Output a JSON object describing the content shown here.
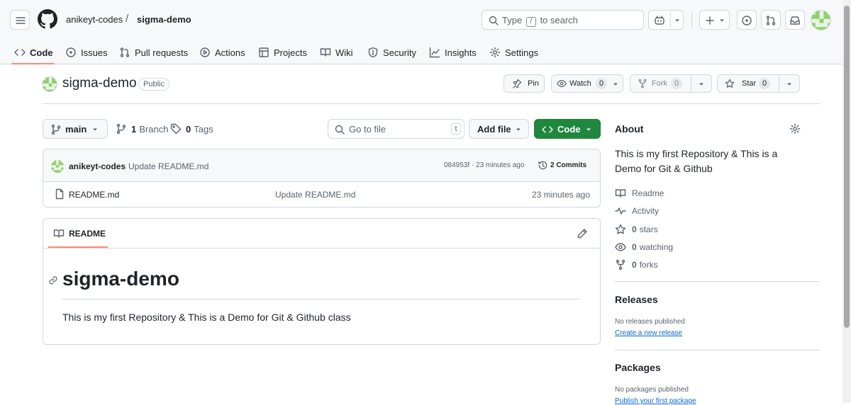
{
  "header": {
    "owner": "anikeyt-codes",
    "separator": "/",
    "repo": "sigma-demo",
    "search_prefix": "Type",
    "search_key": "/",
    "search_suffix": "to search"
  },
  "tabs": [
    {
      "label": "Code",
      "icon": "code-icon",
      "selected": true
    },
    {
      "label": "Issues",
      "icon": "issue-icon"
    },
    {
      "label": "Pull requests",
      "icon": "pull-request-icon"
    },
    {
      "label": "Actions",
      "icon": "play-icon"
    },
    {
      "label": "Projects",
      "icon": "table-icon"
    },
    {
      "label": "Wiki",
      "icon": "book-icon"
    },
    {
      "label": "Security",
      "icon": "shield-icon"
    },
    {
      "label": "Insights",
      "icon": "graph-icon"
    },
    {
      "label": "Settings",
      "icon": "gear-icon"
    }
  ],
  "repo": {
    "name": "sigma-demo",
    "visibility": "Public",
    "pin_label": "Pin",
    "watch_label": "Watch",
    "watch_count": "0",
    "fork_label": "Fork",
    "fork_count": "0",
    "star_label": "Star",
    "star_count": "0"
  },
  "controls": {
    "branch": "main",
    "branch_count": "1",
    "branch_label": "Branch",
    "tag_count": "0",
    "tag_label": "Tags",
    "goto_placeholder": "Go to file",
    "goto_key": "t",
    "add_file": "Add file",
    "code": "Code"
  },
  "commit": {
    "author": "anikeyt-codes",
    "message": "Update README.md",
    "meta": "084953f · 23 minutes ago",
    "commits": "2 Commits"
  },
  "files": [
    {
      "name": "README.md",
      "message": "Update README.md",
      "time": "23 minutes ago"
    }
  ],
  "readme": {
    "tab": "README",
    "heading": "sigma-demo",
    "body": "This is my first Repository & This is a Demo for Git & Github class"
  },
  "about": {
    "title": "About",
    "description": "This is my first Repository & This is a Demo for Git & Github",
    "readme": "Readme",
    "activity": "Activity",
    "stars_count": "0",
    "stars_label": "stars",
    "watching_count": "0",
    "watching_label": "watching",
    "forks_count": "0",
    "forks_label": "forks"
  },
  "releases": {
    "title": "Releases",
    "none": "No releases published",
    "link": "Create a new release"
  },
  "packages": {
    "title": "Packages",
    "none": "No packages published",
    "link": "Publish your first package"
  },
  "colors": {
    "accent_green": "#1f883d",
    "tab_underline": "#fd8c73",
    "link_blue": "#0969da"
  }
}
